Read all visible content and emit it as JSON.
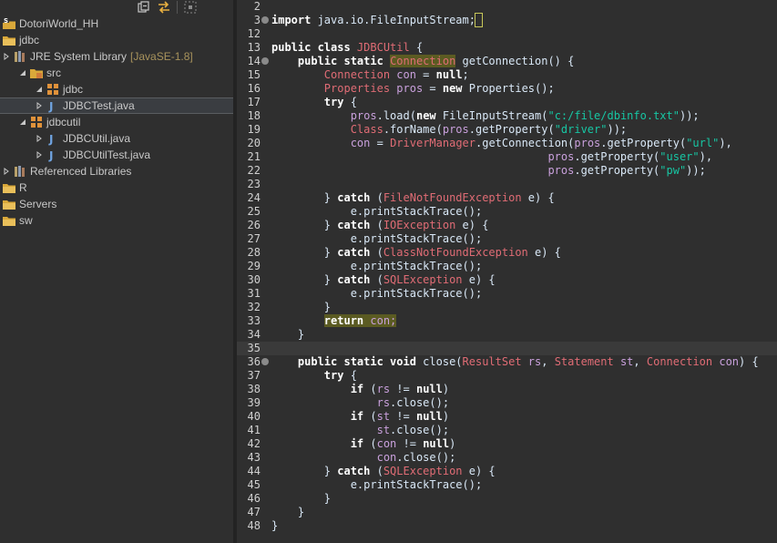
{
  "explorer": {
    "toolbar": [
      "collapse-all-icon",
      "link-with-editor-icon",
      "view-menu-icon"
    ],
    "items": [
      {
        "label": "DotoriWorld_HH",
        "icon": "project-icon",
        "twisty": "",
        "deco": ""
      },
      {
        "label": "jdbc",
        "icon": "project-folder-icon",
        "twisty": "",
        "deco": ""
      },
      {
        "label": "JRE System Library",
        "icon": "library-icon",
        "twisty": "collapsed",
        "deco": "[JavaSE-1.8]"
      },
      {
        "label": "src",
        "icon": "source-folder-icon",
        "twisty": "expanded",
        "deco": ""
      },
      {
        "label": "jdbc",
        "icon": "package-icon",
        "twisty": "expanded",
        "deco": ""
      },
      {
        "label": "JDBCTest.java",
        "icon": "java-file-icon",
        "twisty": "collapsed",
        "deco": ""
      },
      {
        "label": "jdbcutil",
        "icon": "package-icon",
        "twisty": "expanded",
        "deco": ""
      },
      {
        "label": "JDBCUtil.java",
        "icon": "java-file-icon",
        "twisty": "collapsed",
        "deco": ""
      },
      {
        "label": "JDBCUtilTest.java",
        "icon": "java-file-icon",
        "twisty": "collapsed",
        "deco": ""
      },
      {
        "label": "Referenced Libraries",
        "icon": "library-icon",
        "twisty": "collapsed",
        "deco": ""
      },
      {
        "label": "R",
        "icon": "project-folder-icon",
        "twisty": "",
        "deco": ""
      },
      {
        "label": "Servers",
        "icon": "project-folder-icon",
        "twisty": "",
        "deco": ""
      },
      {
        "label": "sw",
        "icon": "project-folder-icon",
        "twisty": "",
        "deco": ""
      }
    ],
    "selected_index": 5
  },
  "editor": {
    "lines": [
      {
        "n": "2",
        "fold": false,
        "tokens": []
      },
      {
        "n": "3",
        "fold": true,
        "tokens": [
          [
            "kw",
            "import"
          ],
          [
            "t",
            " java.io.FileInputStream;"
          ],
          [
            "box",
            " "
          ]
        ]
      },
      {
        "n": "12",
        "fold": false,
        "tokens": []
      },
      {
        "n": "13",
        "fold": false,
        "tokens": [
          [
            "kw",
            "public class "
          ],
          [
            "ty",
            "JDBCUtil"
          ],
          [
            "t",
            " {"
          ]
        ]
      },
      {
        "n": "14",
        "fold": true,
        "tokens": [
          [
            "t",
            "    "
          ],
          [
            "kw",
            "public static "
          ],
          [
            "hl",
            "Connection"
          ],
          [
            "t",
            " getConnection() {"
          ]
        ]
      },
      {
        "n": "15",
        "fold": false,
        "tokens": [
          [
            "t",
            "        "
          ],
          [
            "ty",
            "Connection"
          ],
          [
            "fld",
            " con"
          ],
          [
            "t",
            " = "
          ],
          [
            "kw",
            "null"
          ],
          [
            "t",
            ";"
          ]
        ]
      },
      {
        "n": "16",
        "fold": false,
        "tokens": [
          [
            "t",
            "        "
          ],
          [
            "ty",
            "Properties"
          ],
          [
            "fld",
            " pros"
          ],
          [
            "t",
            " = "
          ],
          [
            "kw",
            "new"
          ],
          [
            "t",
            " Properties();"
          ]
        ]
      },
      {
        "n": "17",
        "fold": false,
        "tokens": [
          [
            "t",
            "        "
          ],
          [
            "kw",
            "try"
          ],
          [
            "t",
            " {"
          ]
        ]
      },
      {
        "n": "18",
        "fold": false,
        "tokens": [
          [
            "t",
            "            "
          ],
          [
            "fld",
            "pros"
          ],
          [
            "t",
            ".load("
          ],
          [
            "kw",
            "new"
          ],
          [
            "t",
            " FileInputStream("
          ],
          [
            "str",
            "\"c:/file/dbinfo.txt\""
          ],
          [
            "t",
            "));"
          ]
        ]
      },
      {
        "n": "19",
        "fold": false,
        "tokens": [
          [
            "t",
            "            "
          ],
          [
            "ty",
            "Class"
          ],
          [
            "t",
            ".forName("
          ],
          [
            "fld",
            "pros"
          ],
          [
            "t",
            ".getProperty("
          ],
          [
            "str",
            "\"driver\""
          ],
          [
            "t",
            "));"
          ]
        ]
      },
      {
        "n": "20",
        "fold": false,
        "tokens": [
          [
            "t",
            "            "
          ],
          [
            "fld",
            "con"
          ],
          [
            "t",
            " = "
          ],
          [
            "ty",
            "DriverManager"
          ],
          [
            "t",
            ".getConnection("
          ],
          [
            "fld",
            "pros"
          ],
          [
            "t",
            ".getProperty("
          ],
          [
            "str",
            "\"url\""
          ],
          [
            "t",
            "),"
          ]
        ]
      },
      {
        "n": "21",
        "fold": false,
        "tokens": [
          [
            "t",
            "                                          "
          ],
          [
            "fld",
            "pros"
          ],
          [
            "t",
            ".getProperty("
          ],
          [
            "str",
            "\"user\""
          ],
          [
            "t",
            "),"
          ]
        ]
      },
      {
        "n": "22",
        "fold": false,
        "tokens": [
          [
            "t",
            "                                          "
          ],
          [
            "fld",
            "pros"
          ],
          [
            "t",
            ".getProperty("
          ],
          [
            "str",
            "\"pw\""
          ],
          [
            "t",
            "));"
          ]
        ]
      },
      {
        "n": "23",
        "fold": false,
        "tokens": []
      },
      {
        "n": "24",
        "fold": false,
        "tokens": [
          [
            "t",
            "        } "
          ],
          [
            "kw",
            "catch"
          ],
          [
            "t",
            " ("
          ],
          [
            "ty",
            "FileNotFoundException"
          ],
          [
            "t",
            " e) {"
          ]
        ]
      },
      {
        "n": "25",
        "fold": false,
        "tokens": [
          [
            "t",
            "            e.printStackTrace();"
          ]
        ]
      },
      {
        "n": "26",
        "fold": false,
        "tokens": [
          [
            "t",
            "        } "
          ],
          [
            "kw",
            "catch"
          ],
          [
            "t",
            " ("
          ],
          [
            "ty",
            "IOException"
          ],
          [
            "t",
            " e) {"
          ]
        ]
      },
      {
        "n": "27",
        "fold": false,
        "tokens": [
          [
            "t",
            "            e.printStackTrace();"
          ]
        ]
      },
      {
        "n": "28",
        "fold": false,
        "tokens": [
          [
            "t",
            "        } "
          ],
          [
            "kw",
            "catch"
          ],
          [
            "t",
            " ("
          ],
          [
            "ty",
            "ClassNotFoundException"
          ],
          [
            "t",
            " e) {"
          ]
        ]
      },
      {
        "n": "29",
        "fold": false,
        "tokens": [
          [
            "t",
            "            e.printStackTrace();"
          ]
        ]
      },
      {
        "n": "30",
        "fold": false,
        "tokens": [
          [
            "t",
            "        } "
          ],
          [
            "kw",
            "catch"
          ],
          [
            "t",
            " ("
          ],
          [
            "ty",
            "SQLException"
          ],
          [
            "t",
            " e) {"
          ]
        ]
      },
      {
        "n": "31",
        "fold": false,
        "tokens": [
          [
            "t",
            "            e.printStackTrace();"
          ]
        ]
      },
      {
        "n": "32",
        "fold": false,
        "tokens": [
          [
            "t",
            "        }"
          ]
        ]
      },
      {
        "n": "33",
        "fold": false,
        "tokens": [
          [
            "t",
            "        "
          ],
          [
            "hlkw",
            "return"
          ],
          [
            "hl",
            " con;"
          ]
        ]
      },
      {
        "n": "34",
        "fold": false,
        "tokens": [
          [
            "t",
            "    }"
          ]
        ]
      },
      {
        "n": "35",
        "fold": false,
        "tokens": [],
        "current": true
      },
      {
        "n": "36",
        "fold": true,
        "tokens": [
          [
            "t",
            "    "
          ],
          [
            "kw",
            "public static void"
          ],
          [
            "t",
            " close("
          ],
          [
            "ty",
            "ResultSet"
          ],
          [
            "fld",
            " rs"
          ],
          [
            "t",
            ", "
          ],
          [
            "ty",
            "Statement"
          ],
          [
            "fld",
            " st"
          ],
          [
            "t",
            ", "
          ],
          [
            "ty",
            "Connection"
          ],
          [
            "fld",
            " con"
          ],
          [
            "t",
            ") {"
          ]
        ]
      },
      {
        "n": "37",
        "fold": false,
        "tokens": [
          [
            "t",
            "        "
          ],
          [
            "kw",
            "try"
          ],
          [
            "t",
            " {"
          ]
        ]
      },
      {
        "n": "38",
        "fold": false,
        "tokens": [
          [
            "t",
            "            "
          ],
          [
            "kw",
            "if"
          ],
          [
            "t",
            " ("
          ],
          [
            "fld",
            "rs"
          ],
          [
            "t",
            " != "
          ],
          [
            "kw",
            "null"
          ],
          [
            "t",
            ")"
          ]
        ]
      },
      {
        "n": "39",
        "fold": false,
        "tokens": [
          [
            "t",
            "                "
          ],
          [
            "fld",
            "rs"
          ],
          [
            "t",
            ".close();"
          ]
        ]
      },
      {
        "n": "40",
        "fold": false,
        "tokens": [
          [
            "t",
            "            "
          ],
          [
            "kw",
            "if"
          ],
          [
            "t",
            " ("
          ],
          [
            "fld",
            "st"
          ],
          [
            "t",
            " != "
          ],
          [
            "kw",
            "null"
          ],
          [
            "t",
            ")"
          ]
        ]
      },
      {
        "n": "41",
        "fold": false,
        "tokens": [
          [
            "t",
            "                "
          ],
          [
            "fld",
            "st"
          ],
          [
            "t",
            ".close();"
          ]
        ]
      },
      {
        "n": "42",
        "fold": false,
        "tokens": [
          [
            "t",
            "            "
          ],
          [
            "kw",
            "if"
          ],
          [
            "t",
            " ("
          ],
          [
            "fld",
            "con"
          ],
          [
            "t",
            " != "
          ],
          [
            "kw",
            "null"
          ],
          [
            "t",
            ")"
          ]
        ]
      },
      {
        "n": "43",
        "fold": false,
        "tokens": [
          [
            "t",
            "                "
          ],
          [
            "fld",
            "con"
          ],
          [
            "t",
            ".close();"
          ]
        ]
      },
      {
        "n": "44",
        "fold": false,
        "tokens": [
          [
            "t",
            "        } "
          ],
          [
            "kw",
            "catch"
          ],
          [
            "t",
            " ("
          ],
          [
            "ty",
            "SQLException"
          ],
          [
            "t",
            " e) {"
          ]
        ]
      },
      {
        "n": "45",
        "fold": false,
        "tokens": [
          [
            "t",
            "            e.printStackTrace();"
          ]
        ]
      },
      {
        "n": "46",
        "fold": false,
        "tokens": [
          [
            "t",
            "        }"
          ]
        ]
      },
      {
        "n": "47",
        "fold": false,
        "tokens": [
          [
            "t",
            "    }"
          ]
        ]
      },
      {
        "n": "48",
        "fold": false,
        "tokens": [
          [
            "t",
            "}"
          ]
        ]
      }
    ]
  }
}
